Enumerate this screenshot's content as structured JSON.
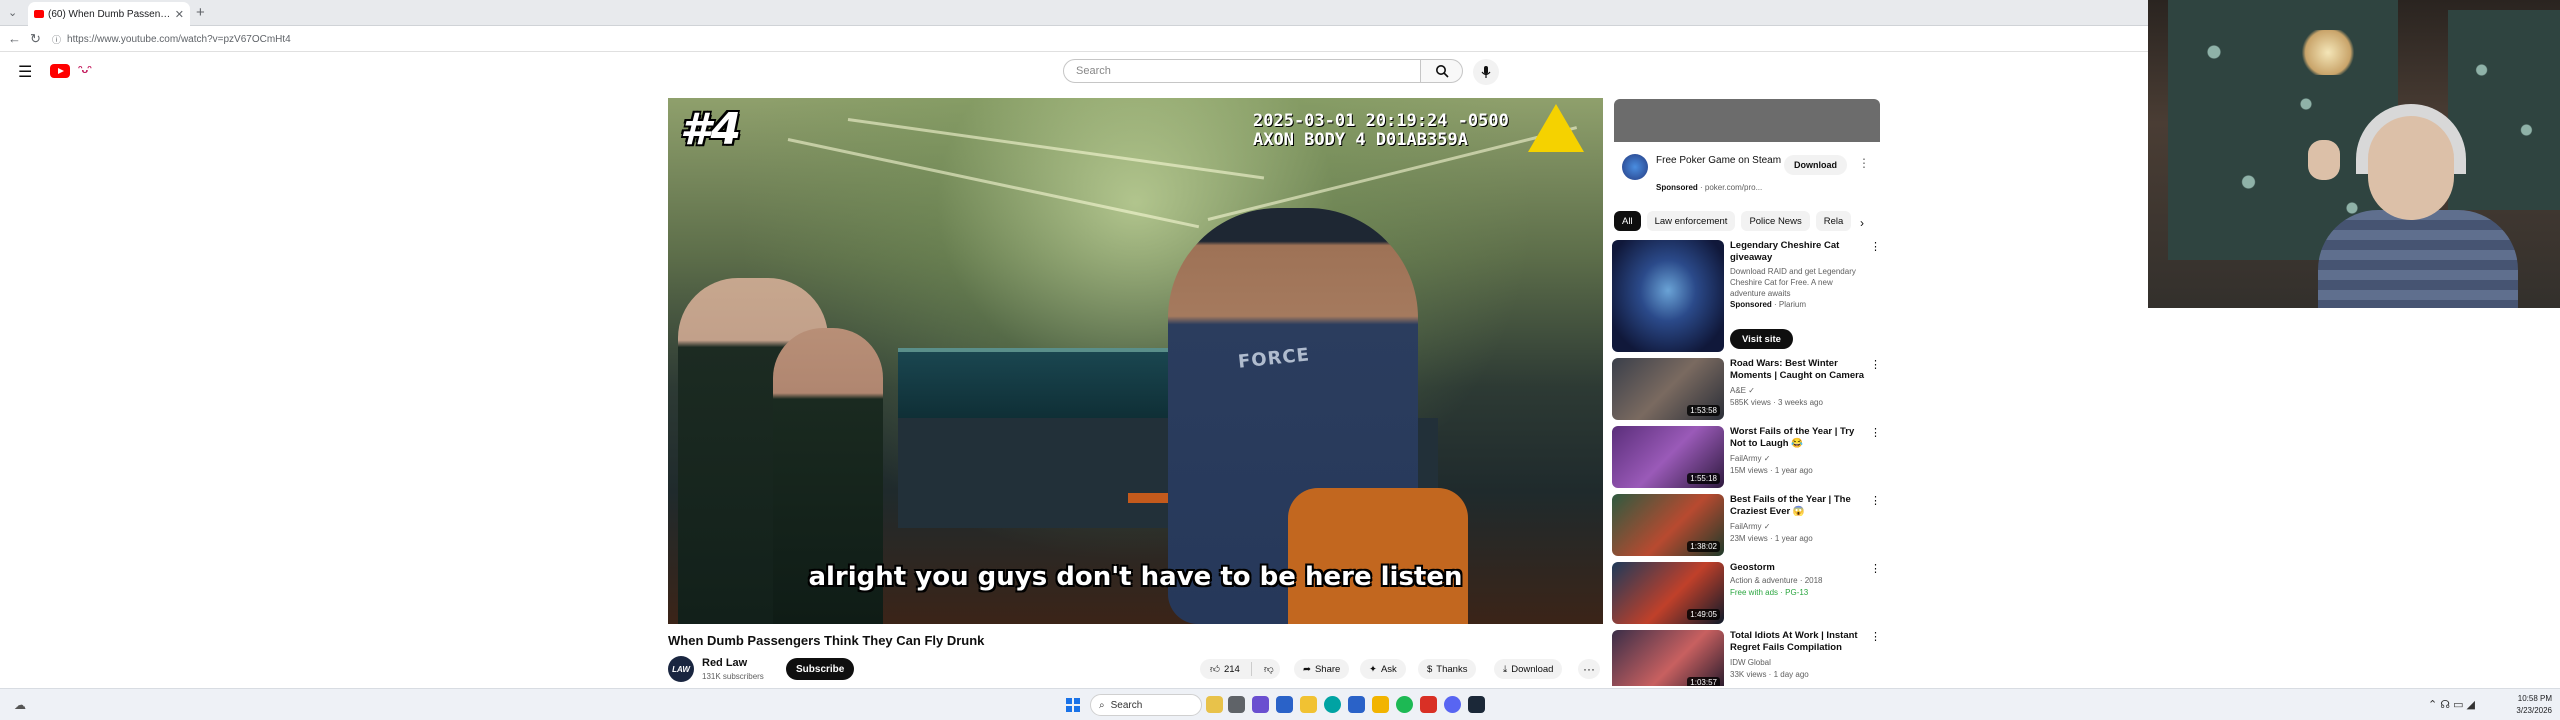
{
  "browser": {
    "tab_title": "(60) When Dumb Passengers",
    "tab_close": "✕",
    "new_tab": "+",
    "url": "https://www.youtube.com/watch?v=pzV67OCmHt4"
  },
  "youtube_header": {
    "search_placeholder": "Search"
  },
  "player": {
    "rank": "#4",
    "timestamp": "2025-03-01 20:19:24 -0500\nAXON BODY 4 D01AB359A",
    "caption": "alright you guys don't have to be here listen",
    "officer_shirt_text": "FORCE"
  },
  "video": {
    "title": "When Dumb Passengers Think They Can Fly Drunk",
    "channel": "Red Law",
    "subscribers": "131K subscribers",
    "channel_avatar_text": "LAW",
    "subscribe_label": "Subscribe",
    "like_count": "214",
    "share_label": "Share",
    "ask_label": "Ask",
    "thanks_label": "Thanks",
    "download_label": "Download",
    "more_label": "···"
  },
  "sidebar": {
    "ad": {
      "title": "Free Poker Game on Steam",
      "sponsored": "Sponsored",
      "sponsor_domain": "poker.com/pro...",
      "download_label": "Download"
    },
    "chips": [
      "All",
      "Law enforcement",
      "Police News",
      "Rela"
    ],
    "rec_ad": {
      "title": "Legendary Cheshire Cat giveaway",
      "description": "Download RAID and get Legendary Cheshire Cat for Free. A new adventure awaits",
      "sponsored": "Sponsored",
      "advertiser": "Plarium",
      "cta": "Visit site"
    },
    "videos": [
      {
        "title": "Road Wars: Best Winter Moments | Caught on Camera ...",
        "channel": "A&E ✓",
        "meta": "585K views · 3 weeks ago",
        "duration": "1:53:58"
      },
      {
        "title": "Worst Fails of the Year | Try Not to Laugh 😂",
        "channel": "FailArmy ✓",
        "meta": "15M views · 1 year ago",
        "duration": "1:55:18"
      },
      {
        "title": "Best Fails of the Year | The Craziest Ever 😱",
        "channel": "FailArmy ✓",
        "meta": "23M views · 1 year ago",
        "duration": "1:38:02"
      },
      {
        "title": "Geostorm",
        "channel": "Action & adventure · 2018",
        "meta": "Free with ads · PG-13",
        "duration": "1:49:05"
      },
      {
        "title": "Total Idiots At Work | Instant Regret Fails Compilation 2026...",
        "channel": "IDW Global",
        "meta": "33K views · 1 day ago",
        "duration": "1:03:57"
      }
    ]
  },
  "taskbar": {
    "search_label": "Search",
    "time": "10:58 PM",
    "date": "3/23/2026"
  }
}
